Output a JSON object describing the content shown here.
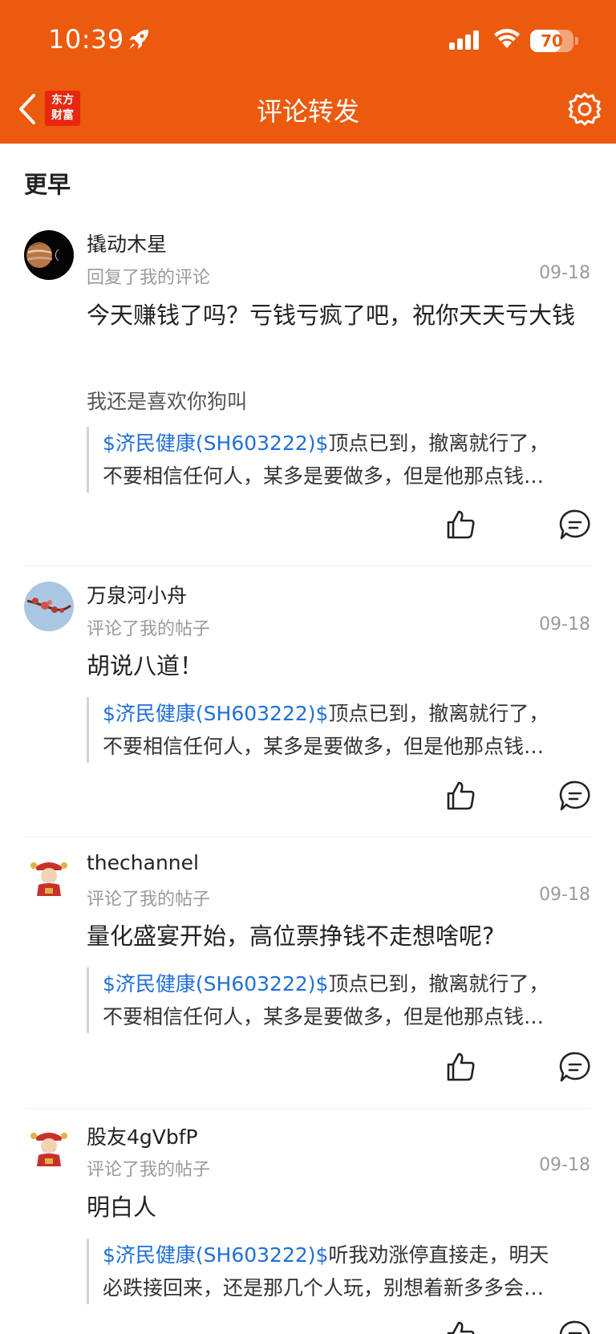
{
  "status_bar": {
    "time": "10:39",
    "battery": "70",
    "battery_level": 0.7
  },
  "header": {
    "title": "评论转发",
    "logo_line1": "东方",
    "logo_line2": "财富"
  },
  "section": {
    "title": "更早"
  },
  "icons": {
    "back": "chevron-left-icon",
    "settings": "gear-icon",
    "like": "thumbs-up-icon",
    "comment": "comment-bubble-icon"
  },
  "colors": {
    "brand": "#EB5A0D",
    "link": "#1F6FD8"
  },
  "items": [
    {
      "username": "撬动木星",
      "action": "回复了我的评论",
      "date": "09-18",
      "comment": "今天赚钱了吗？亏钱亏疯了吧，祝你天天亏大钱",
      "reply": "我还是喜欢你狗叫",
      "ticker": "$济民健康(SH603222)$",
      "quote_rest": "顶点已到，撤离就行了，",
      "quote_line2": "不要相信任何人，某多是要做多，但是他那点钱…"
    },
    {
      "username": "万泉河小舟",
      "action": "评论了我的帖子",
      "date": "09-18",
      "comment": "胡说八道！",
      "ticker": "$济民健康(SH603222)$",
      "quote_rest": "顶点已到，撤离就行了，",
      "quote_line2": "不要相信任何人，某多是要做多，但是他那点钱…"
    },
    {
      "username": "thechannel",
      "action": "评论了我的帖子",
      "date": "09-18",
      "comment": "量化盛宴开始，高位票挣钱不走想啥呢?",
      "ticker": "$济民健康(SH603222)$",
      "quote_rest": "顶点已到，撤离就行了，",
      "quote_line2": "不要相信任何人，某多是要做多，但是他那点钱…"
    },
    {
      "username": "股友4gVbfP",
      "action": "评论了我的帖子",
      "date": "09-18",
      "comment": "明白人",
      "ticker": "$济民健康(SH603222)$",
      "quote_rest": "听我劝涨停直接走，明天",
      "quote_line2": "必跌接回来，还是那几个人玩，别想着新多多会…"
    }
  ]
}
